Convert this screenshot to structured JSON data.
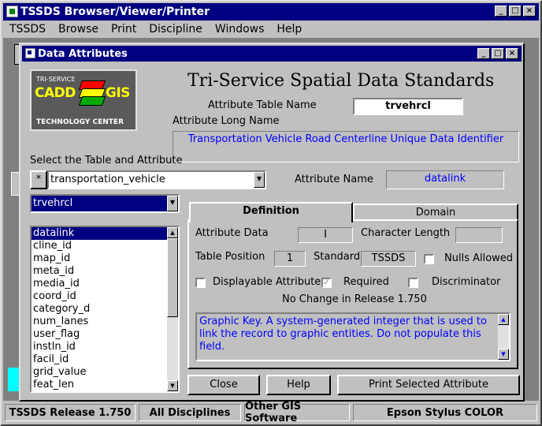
{
  "app": {
    "title": "TSSDS Browser/Viewer/Printer"
  },
  "menu": [
    "TSSDS",
    "Browse",
    "Print",
    "Discipline",
    "Windows",
    "Help"
  ],
  "window_buttons": [
    "_",
    "□",
    "×"
  ],
  "dialog": {
    "title": "Data Attributes",
    "heading": "Tri-Service Spatial Data Standards",
    "logo": {
      "line1": "TRI-SERVICE",
      "cadd": "CADD",
      "gis": "GIS",
      "line2": "TECHNOLOGY CENTER"
    },
    "attribute_table_name_label": "Attribute Table Name",
    "attribute_table_name_value": "trvehrcl",
    "attribute_long_name_label": "Attribute Long Name",
    "attribute_long_name_value": "Transportation Vehicle Road Centerline Unique Data Identifier",
    "select_label": "Select the Table and Attribute",
    "entity_prefix": "*",
    "entity_value": "transportation_vehicle",
    "table_value": "trvehrcl",
    "attribute_name_label": "Attribute Name",
    "attribute_name_value": "datalink",
    "attributes": [
      "datalink",
      "cline_id",
      "map_id",
      "meta_id",
      "media_id",
      "coord_id",
      "category_d",
      "num_lanes",
      "user_flag",
      "instln_id",
      "facil_id",
      "grid_value",
      "feat_len"
    ],
    "selected_attribute": "datalink",
    "tabs": [
      "Definition",
      "Domain"
    ],
    "active_tab": "Definition",
    "definition": {
      "attribute_data_label": "Attribute Data",
      "attribute_data_value": "I",
      "character_length_label": "Character Length",
      "character_length_value": "",
      "table_position_label": "Table Position",
      "table_position_value": "1",
      "standard_label": "Standard",
      "standard_value": "TSSDS",
      "nulls_allowed_label": "Nulls Allowed",
      "nulls_allowed": false,
      "displayable_label": "Displayable Attribute",
      "displayable": false,
      "required_label": "Required",
      "required": true,
      "discriminator_label": "Discriminator",
      "discriminator": false,
      "release_note": "No Change in Release 1.750",
      "description": "Graphic Key.  A system-generated integer that is used to link the record to graphic entities.  Do not populate this field."
    },
    "buttons": {
      "close": "Close",
      "help": "Help",
      "print": "Print Selected Attribute"
    }
  },
  "status": [
    "TSSDS Release 1.750",
    "All Disciplines",
    "Other GIS Software",
    "Epson Stylus COLOR"
  ]
}
